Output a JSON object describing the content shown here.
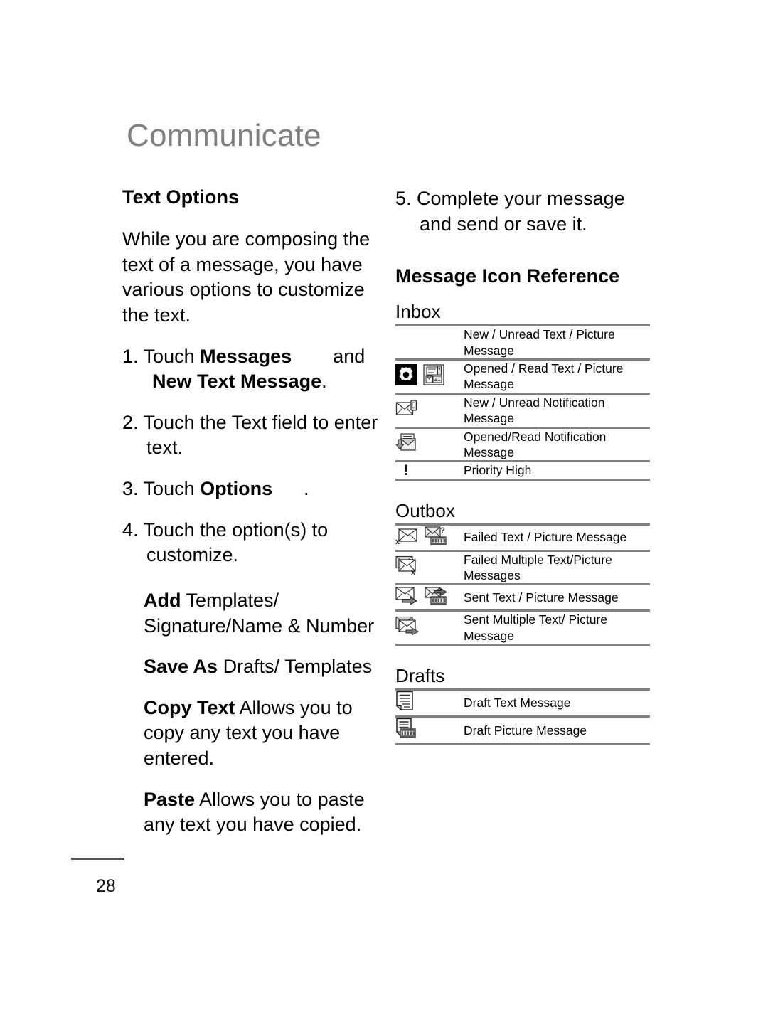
{
  "chapter": {
    "title": "Communicate"
  },
  "left": {
    "section_heading": "Text Options",
    "intro": "While you are composing the text of a message, you have various options to customize the text.",
    "steps": [
      {
        "num": "1.",
        "pre": "Touch ",
        "bold1": "Messages",
        "mid": "and",
        "bold2": "New Text Message",
        "post": "."
      },
      {
        "num": "2.",
        "text": "Touch the Text field to enter text."
      },
      {
        "num": "3.",
        "pre": "Touch ",
        "bold1": "Options",
        "post": "."
      },
      {
        "num": "4.",
        "text": "Touch the option(s) to customize."
      }
    ],
    "options": [
      {
        "bold": "Add",
        "rest": " Templates/ Signature/Name & Number"
      },
      {
        "bold": "Save As",
        "rest": " Drafts/ Templates"
      },
      {
        "bold": "Copy Text",
        "rest": " Allows you to copy any text you have entered."
      },
      {
        "bold": "Paste",
        "rest": " Allows you to paste any text you have copied."
      }
    ]
  },
  "right": {
    "step5": {
      "num": "5.",
      "text": "Complete your message and send or save it."
    },
    "section_heading": "Message Icon Reference",
    "groups": [
      {
        "title": "Inbox",
        "rows": [
          {
            "icons": [],
            "label": "New / Unread Text / Picture Message"
          },
          {
            "icons": [
              "gear-black-square-icon",
              "opened-picture-message-icon"
            ],
            "label": "Opened / Read Text / Picture Message"
          },
          {
            "icons": [
              "new-notification-envelope-icon"
            ],
            "label": "New / Unread Notification Message"
          },
          {
            "icons": [
              "opened-notification-envelope-icon"
            ],
            "label": "Opened/Read Notification Message"
          },
          {
            "icons": [
              "priority-high-icon"
            ],
            "label": "Priority High"
          }
        ]
      },
      {
        "title": "Outbox",
        "rows": [
          {
            "icons": [
              "failed-text-envelope-icon",
              "failed-picture-message-icon"
            ],
            "label": "Failed Text / Picture Message"
          },
          {
            "icons": [
              "failed-multiple-envelope-icon"
            ],
            "label": "Failed Multiple Text/Picture Messages"
          },
          {
            "icons": [
              "sent-text-envelope-icon",
              "sent-picture-message-icon"
            ],
            "label": "Sent Text / Picture Message"
          },
          {
            "icons": [
              "sent-multiple-envelope-icon"
            ],
            "label": "Sent Multiple Text/ Picture Message"
          }
        ]
      },
      {
        "title": "Drafts",
        "rows": [
          {
            "icons": [
              "draft-text-document-icon"
            ],
            "label": "Draft Text Message"
          },
          {
            "icons": [
              "draft-picture-document-icon"
            ],
            "label": "Draft Picture Message"
          }
        ]
      }
    ]
  },
  "footer": {
    "page_number": "28"
  },
  "colors": {
    "chapter_title": "#808080",
    "rule": "#808080",
    "text": "#000000"
  }
}
